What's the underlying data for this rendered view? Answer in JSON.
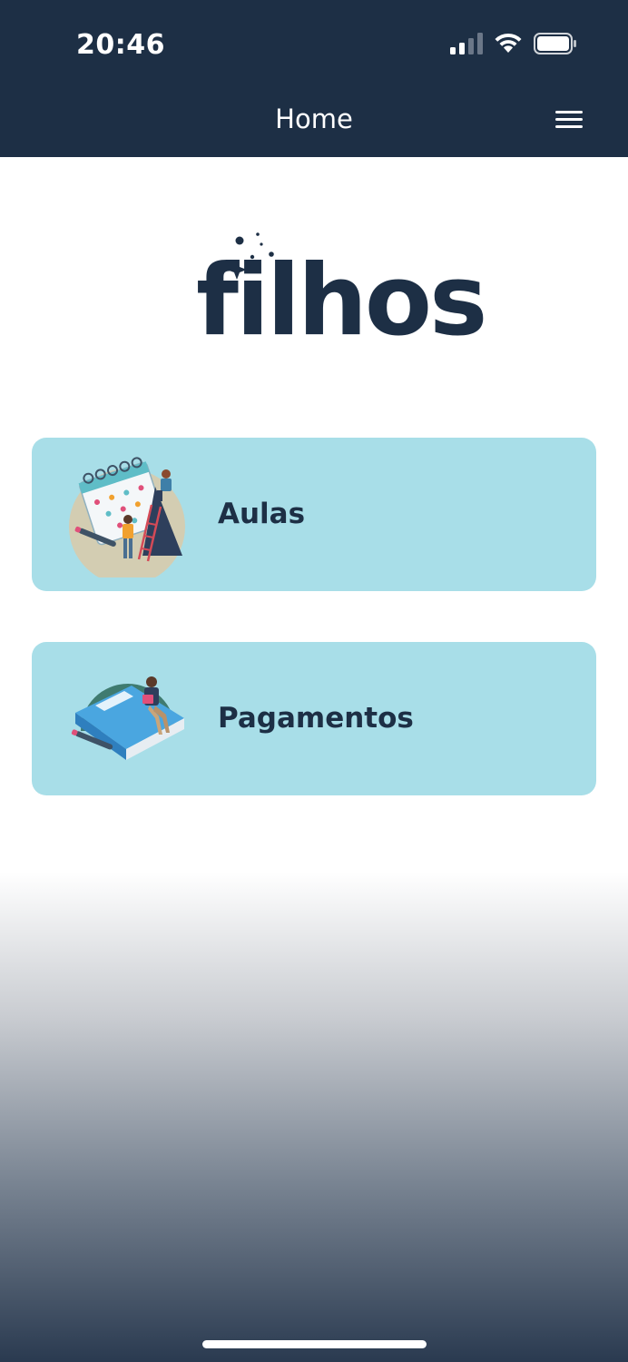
{
  "status_bar": {
    "time": "20:46",
    "icons": [
      "cellular-signal-icon",
      "wifi-icon",
      "battery-icon"
    ]
  },
  "nav": {
    "title": "Home",
    "menu_icon": "hamburger-menu-icon"
  },
  "logo": {
    "text": "filhos"
  },
  "cards": [
    {
      "label": "Aulas",
      "icon": "calendar-illustration"
    },
    {
      "label": "Pagamentos",
      "icon": "book-reading-illustration"
    }
  ],
  "colors": {
    "header": "#1d2f45",
    "card": "#a8dee8",
    "text_dark": "#1d2f45"
  }
}
